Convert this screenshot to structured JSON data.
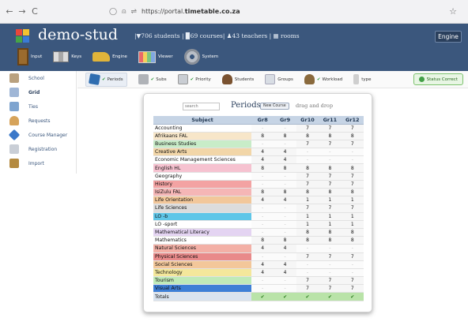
{
  "browser": {
    "back": "←",
    "forward": "→",
    "reload": "C",
    "url_prefix": "https://portal.",
    "url_host": "timetable.co.za"
  },
  "app": {
    "title": "demo-stud",
    "stats": "|▼706 students | ▉69 courses| ♟43 teachers | ▦ rooms",
    "engine_button": "Engine",
    "nav": [
      "Input",
      "Keys",
      "Engine",
      "Viewer",
      "System"
    ]
  },
  "sidebar": {
    "items": [
      {
        "label": "School",
        "icon": "school-icon"
      },
      {
        "label": "Grid",
        "icon": "grid-icon"
      },
      {
        "label": "Ties",
        "icon": "ties-icon"
      },
      {
        "label": "Requests",
        "icon": "requests-icon"
      },
      {
        "label": "Course Manager",
        "icon": "course-manager-icon"
      },
      {
        "label": "Registration",
        "icon": "registration-icon"
      },
      {
        "label": "Import",
        "icon": "import-icon"
      }
    ]
  },
  "toolbar": {
    "items": [
      {
        "label": "Periods",
        "check": "✔"
      },
      {
        "label": "Subs",
        "check": "✔"
      },
      {
        "label": "Priority",
        "check": "✔"
      },
      {
        "label": "Students",
        "check": ""
      },
      {
        "label": "Groups",
        "check": ""
      },
      {
        "label": "Workload",
        "check": "✔"
      },
      {
        "label": "type",
        "check": ""
      }
    ],
    "status": "Status Correct"
  },
  "panel": {
    "search_placeholder": "search",
    "title": "Periods",
    "new_course": "New Course",
    "drag_text": "drag and drop"
  },
  "table": {
    "headers": [
      "Subject",
      "Gr8",
      "Gr9",
      "Gr10",
      "Gr11",
      "Gr12"
    ],
    "rows": [
      {
        "subject": "Accounting",
        "color": "#ffffff",
        "values": [
          "-",
          "-",
          "7",
          "7",
          "7"
        ]
      },
      {
        "subject": "Afrikaans FAL",
        "color": "#f7e6c9",
        "values": [
          "8",
          "8",
          "8",
          "8",
          "8"
        ]
      },
      {
        "subject": "Business Studies",
        "color": "#c8ecc8",
        "values": [
          "-",
          "-",
          "7",
          "7",
          "7"
        ]
      },
      {
        "subject": "Creative Arts",
        "color": "#f2d6a8",
        "values": [
          "4",
          "4",
          "-",
          "-",
          "-"
        ]
      },
      {
        "subject": "Economic Management Sciences",
        "color": "#ffffff",
        "values": [
          "4",
          "4",
          "-",
          "-",
          "-"
        ]
      },
      {
        "subject": "English HL",
        "color": "#f6c2d0",
        "values": [
          "8",
          "8",
          "8",
          "8",
          "8"
        ]
      },
      {
        "subject": "Geography",
        "color": "#ffffff",
        "values": [
          "-",
          "-",
          "7",
          "7",
          "7"
        ]
      },
      {
        "subject": "History",
        "color": "#f3a3a3",
        "values": [
          "-",
          "-",
          "7",
          "7",
          "7"
        ]
      },
      {
        "subject": "IsiZulu FAL",
        "color": "#f5b6b6",
        "values": [
          "8",
          "8",
          "8",
          "8",
          "8"
        ]
      },
      {
        "subject": "Life Orientation",
        "color": "#f2c79a",
        "values": [
          "4",
          "4",
          "1",
          "1",
          "1"
        ]
      },
      {
        "subject": "Life Sciences",
        "color": "#dcdcdc",
        "values": [
          "-",
          "-",
          "7",
          "7",
          "7"
        ]
      },
      {
        "subject": "LO -b",
        "color": "#5ec6e8",
        "values": [
          "-",
          "-",
          "1",
          "1",
          "1"
        ]
      },
      {
        "subject": "LO -sport",
        "color": "#ffffff",
        "values": [
          "-",
          "-",
          "1",
          "1",
          "1"
        ]
      },
      {
        "subject": "Mathematical Literacy",
        "color": "#e4d4f2",
        "values": [
          "-",
          "-",
          "8",
          "8",
          "8"
        ]
      },
      {
        "subject": "Mathematics",
        "color": "#ffffff",
        "values": [
          "8",
          "8",
          "8",
          "8",
          "8"
        ]
      },
      {
        "subject": "Natural Sciences",
        "color": "#f3b0a6",
        "values": [
          "4",
          "4",
          "-",
          "-",
          "-"
        ]
      },
      {
        "subject": "Physical Sciences",
        "color": "#e98a8a",
        "values": [
          "-",
          "-",
          "7",
          "7",
          "7"
        ]
      },
      {
        "subject": "Social Sciences",
        "color": "#f3c79a",
        "values": [
          "4",
          "4",
          "-",
          "-",
          "-"
        ]
      },
      {
        "subject": "Technology",
        "color": "#f4e79b",
        "values": [
          "4",
          "4",
          "-",
          "-",
          "-"
        ]
      },
      {
        "subject": "Tourism",
        "color": "#bfeab8",
        "values": [
          "-",
          "-",
          "7",
          "7",
          "7"
        ]
      },
      {
        "subject": "Visual Arts",
        "color": "#3d7fd6",
        "values": [
          "-",
          "-",
          "7",
          "7",
          "7"
        ]
      }
    ],
    "totals_label": "Totals",
    "totals": [
      "✔",
      "✔",
      "✔",
      "✔",
      "✔"
    ]
  }
}
